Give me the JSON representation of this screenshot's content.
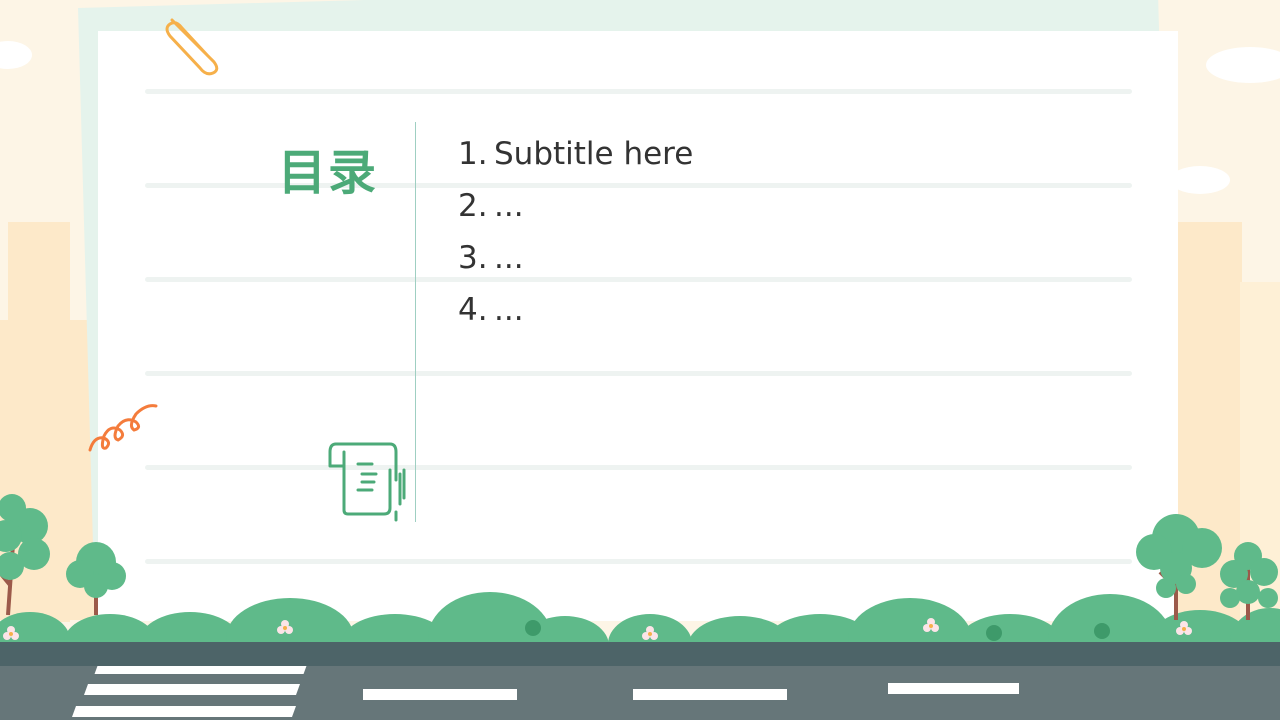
{
  "toc": {
    "title": "目录",
    "items": [
      {
        "num": "1.",
        "text": "Subtitle here"
      },
      {
        "num": "2.",
        "text": "..."
      },
      {
        "num": "3.",
        "text": "..."
      },
      {
        "num": "4.",
        "text": "..."
      }
    ]
  },
  "colors": {
    "accent": "#4caa78",
    "hill": "#5fba8a",
    "road": "#667679",
    "paper": "#ffffff",
    "clip": "#f6b04a",
    "squiggle": "#f47c3c"
  },
  "icons": [
    "paperclip-icon",
    "squiggle-icon",
    "scroll-document-icon",
    "tree-icon",
    "flower-icon"
  ]
}
